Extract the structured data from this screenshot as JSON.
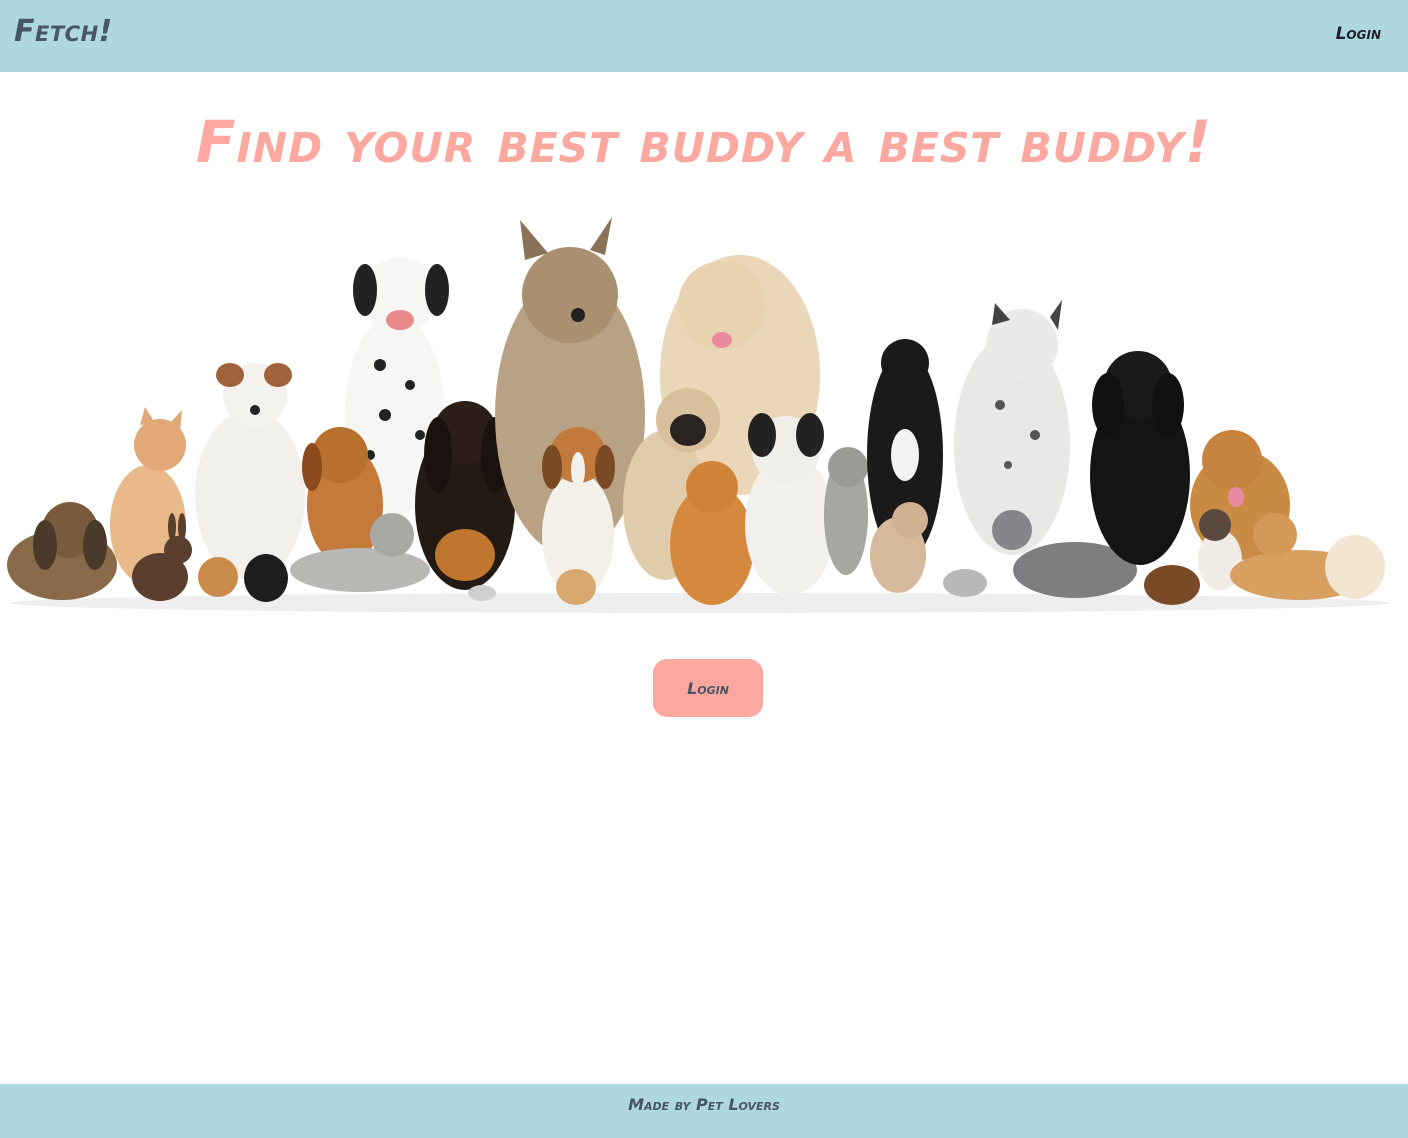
{
  "navbar": {
    "brand": "Fetch!",
    "login_label": "Login"
  },
  "hero": {
    "headline": "Find your best buddy a best buddy!",
    "image_alt": "group of dogs, cats and small pets"
  },
  "main": {
    "login_button_label": "Login"
  },
  "footer": {
    "text": "Made by Pet Lovers"
  },
  "colors": {
    "navbar_bg": "#aed8df",
    "accent": "#fba8a0",
    "text_dark": "#4a5563"
  }
}
